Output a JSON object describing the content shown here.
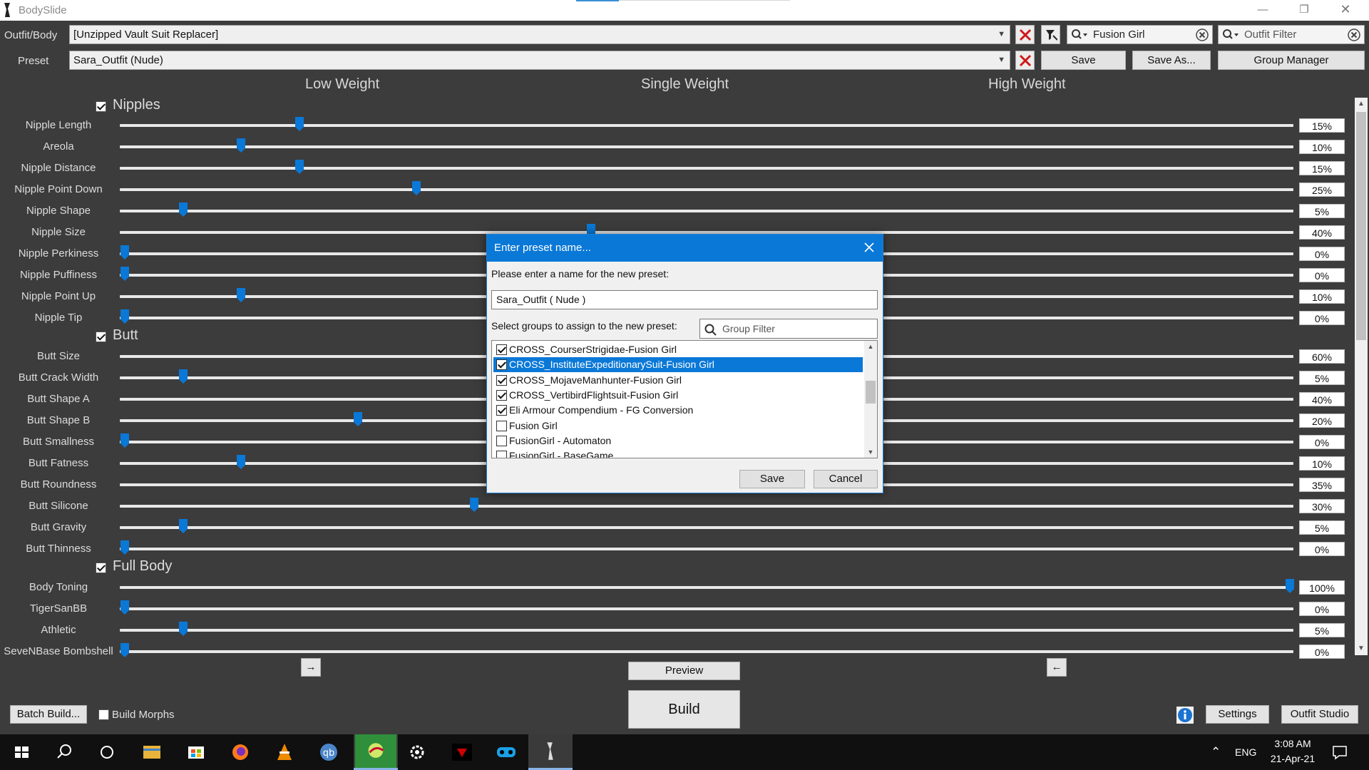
{
  "window": {
    "title": "BodySlide"
  },
  "toolbar": {
    "outfit_label": "Outfit/Body",
    "outfit_value": "[Unzipped Vault Suit Replacer]",
    "preset_label": "Preset",
    "preset_value": "Sara_Outfit (Nude)",
    "group_search_value": "Fusion Girl",
    "outfit_filter_placeholder": "Outfit Filter",
    "save": "Save",
    "save_as": "Save As...",
    "group_manager": "Group Manager"
  },
  "columns": {
    "low": "Low Weight",
    "single": "Single Weight",
    "high": "High Weight"
  },
  "groups": [
    {
      "title": "Nipples",
      "checked": true
    },
    {
      "title": "Butt",
      "checked": true
    },
    {
      "title": "Full Body",
      "checked": true
    }
  ],
  "sliders": [
    {
      "label": "Nipple Length",
      "value": "15%",
      "pct": 15
    },
    {
      "label": "Areola",
      "value": "10%",
      "pct": 10
    },
    {
      "label": "Nipple Distance",
      "value": "15%",
      "pct": 15
    },
    {
      "label": "Nipple Point Down",
      "value": "25%",
      "pct": 25
    },
    {
      "label": "Nipple Shape",
      "value": "5%",
      "pct": 5
    },
    {
      "label": "Nipple Size",
      "value": "40%",
      "pct": 40
    },
    {
      "label": "Nipple Perkiness",
      "value": "0%",
      "pct": 0
    },
    {
      "label": "Nipple Puffiness",
      "value": "0%",
      "pct": 0
    },
    {
      "label": "Nipple Point Up",
      "value": "10%",
      "pct": 10
    },
    {
      "label": "Nipple Tip",
      "value": "0%",
      "pct": 0
    },
    {
      "label": "Butt Size",
      "value": "60%",
      "pct": 60
    },
    {
      "label": "Butt Crack Width",
      "value": "5%",
      "pct": 5
    },
    {
      "label": "Butt Shape A",
      "value": "40%",
      "pct": 40
    },
    {
      "label": "Butt Shape B",
      "value": "20%",
      "pct": 20
    },
    {
      "label": "Butt Smallness",
      "value": "0%",
      "pct": 0
    },
    {
      "label": "Butt Fatness",
      "value": "10%",
      "pct": 10
    },
    {
      "label": "Butt Roundness",
      "value": "35%",
      "pct": 35
    },
    {
      "label": "Butt Silicone",
      "value": "30%",
      "pct": 30
    },
    {
      "label": "Butt Gravity",
      "value": "5%",
      "pct": 5
    },
    {
      "label": "Butt Thinness",
      "value": "0%",
      "pct": 0
    },
    {
      "label": "Body Toning",
      "value": "100%",
      "pct": 100
    },
    {
      "label": "TigerSanBB",
      "value": "0%",
      "pct": 0
    },
    {
      "label": "Athletic",
      "value": "5%",
      "pct": 5
    },
    {
      "label": "SeveNBase Bombshell",
      "value": "0%",
      "pct": 0
    }
  ],
  "dialog": {
    "title": "Enter preset name...",
    "prompt": "Please enter a name for the new preset:",
    "name_value": "Sara_Outfit ( Nude )",
    "groups_prompt": "Select groups to assign to the new preset:",
    "filter_placeholder": "Group Filter",
    "items": [
      {
        "label": "CROSS_CourserStrigidae-Fusion Girl",
        "checked": true,
        "selected": false
      },
      {
        "label": "CROSS_InstituteExpeditionarySuit-Fusion Girl",
        "checked": true,
        "selected": true
      },
      {
        "label": "CROSS_MojaveManhunter-Fusion Girl",
        "checked": true,
        "selected": false
      },
      {
        "label": "CROSS_VertibirdFlightsuit-Fusion Girl",
        "checked": true,
        "selected": false
      },
      {
        "label": "Eli Armour Compendium - FG Conversion",
        "checked": true,
        "selected": false
      },
      {
        "label": "Fusion Girl",
        "checked": false,
        "selected": false
      },
      {
        "label": "FusionGirl - Automaton",
        "checked": false,
        "selected": false
      },
      {
        "label": "FusionGirl - BaseGame",
        "checked": false,
        "selected": false
      }
    ],
    "save": "Save",
    "cancel": "Cancel"
  },
  "bottom": {
    "left_arrow": "→",
    "right_arrow": "←",
    "preview": "Preview",
    "build": "Build",
    "batch_build": "Batch Build...",
    "build_morphs": "Build Morphs",
    "settings": "Settings",
    "outfit_studio": "Outfit Studio"
  },
  "taskbar": {
    "lang": "ENG",
    "time": "3:08 AM",
    "date": "21-Apr-21"
  },
  "colors": {
    "accent": "#0a78d7",
    "thumb": "#0a78d7",
    "background": "#3c3c3c"
  }
}
